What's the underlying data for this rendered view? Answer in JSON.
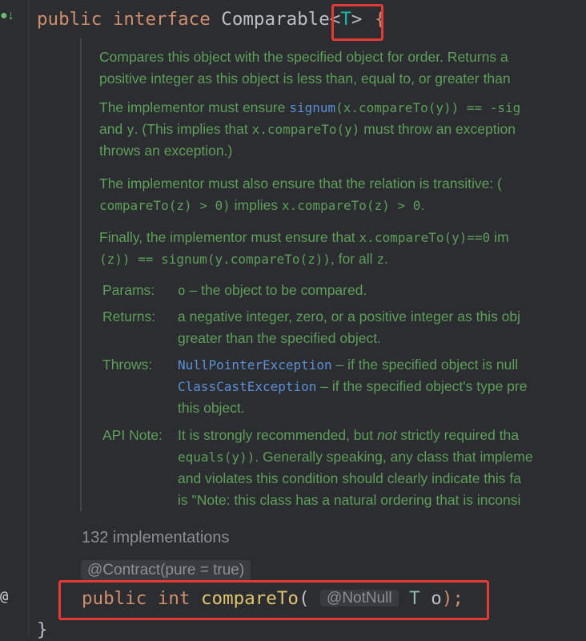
{
  "gutter": {
    "top_icon": "implemented-by-icon",
    "bottom_icon": "annotation-icon",
    "bottom_glyph": "@"
  },
  "header": {
    "kw_public": "public",
    "kw_interface": "interface",
    "class_name": "Comparable",
    "type_open": "<",
    "type_param": "T",
    "type_close": ">",
    "brace_open": "{"
  },
  "doc": {
    "p1_l1": "Compares this object with the specified object for order. Returns a",
    "p1_l2": "positive integer as this object is less than, equal to, or greater than",
    "p2_l1_a": "The implementor must ensure ",
    "p2_l1_link": "signum",
    "p2_l1_code": "(x.compareTo(y)) == -sig",
    "p2_l2_a": "and ",
    "p2_l2_code1": "y",
    "p2_l2_b": ". (This implies that ",
    "p2_l2_code2": "x.compareTo(y)",
    "p2_l2_c": " must throw an exception",
    "p2_l3": "throws an exception.)",
    "p3_l1_a": "The implementor must also ensure that the relation is transitive: (",
    "p3_l2_code1": "compareTo(z) > 0)",
    "p3_l2_a": " implies ",
    "p3_l2_code2": "x.compareTo(z) > 0",
    "p3_l2_b": ".",
    "p4_l1_a": "Finally, the implementor must ensure that ",
    "p4_l1_code": "x.compareTo(y)==0",
    "p4_l1_b": " im",
    "p4_l2_code": "(z)) == signum(y.compareTo(z))",
    "p4_l2_a": ", for all ",
    "p4_l2_code2": "z",
    "p4_l2_b": ".",
    "params_label": "Params:",
    "params_code": "o",
    "params_text": " – the object to be compared.",
    "returns_label": "Returns:",
    "returns_l1": "a negative integer, zero, or a positive integer as this obj",
    "returns_l2": "greater than the specified object.",
    "throws_label": "Throws:",
    "throws_link1": "NullPointerException",
    "throws_text1": " – if the specified object is null",
    "throws_link2": "ClassCastException",
    "throws_text2": " – if the specified object's type pre",
    "throws_l3": "this object.",
    "apinote_label": "API Note:",
    "apinote_l1_a": "It is strongly recommended, but ",
    "apinote_l1_em": "not",
    "apinote_l1_b": " strictly required tha",
    "apinote_l2_code": "equals(y))",
    "apinote_l2_a": ". Generally speaking, any class that impleme",
    "apinote_l3": "and violates this condition should clearly indicate this fa",
    "apinote_l4": "is \"Note: this class has a natural ordering that is inconsi"
  },
  "implementations": "132 implementations",
  "contract_annotation": "@Contract(pure = true)",
  "method": {
    "kw_public": "public",
    "kw_int": "int",
    "name": "compareTo",
    "paren_open": "(",
    "annotation": "@NotNull",
    "param_type": "T",
    "param_name": "o",
    "paren_close": ");"
  },
  "closing_brace": "}",
  "colors": {
    "highlight": "#e53935",
    "keyword": "#cf8e6d",
    "doc_green": "#5f9e5b",
    "link": "#5c8fd6"
  }
}
